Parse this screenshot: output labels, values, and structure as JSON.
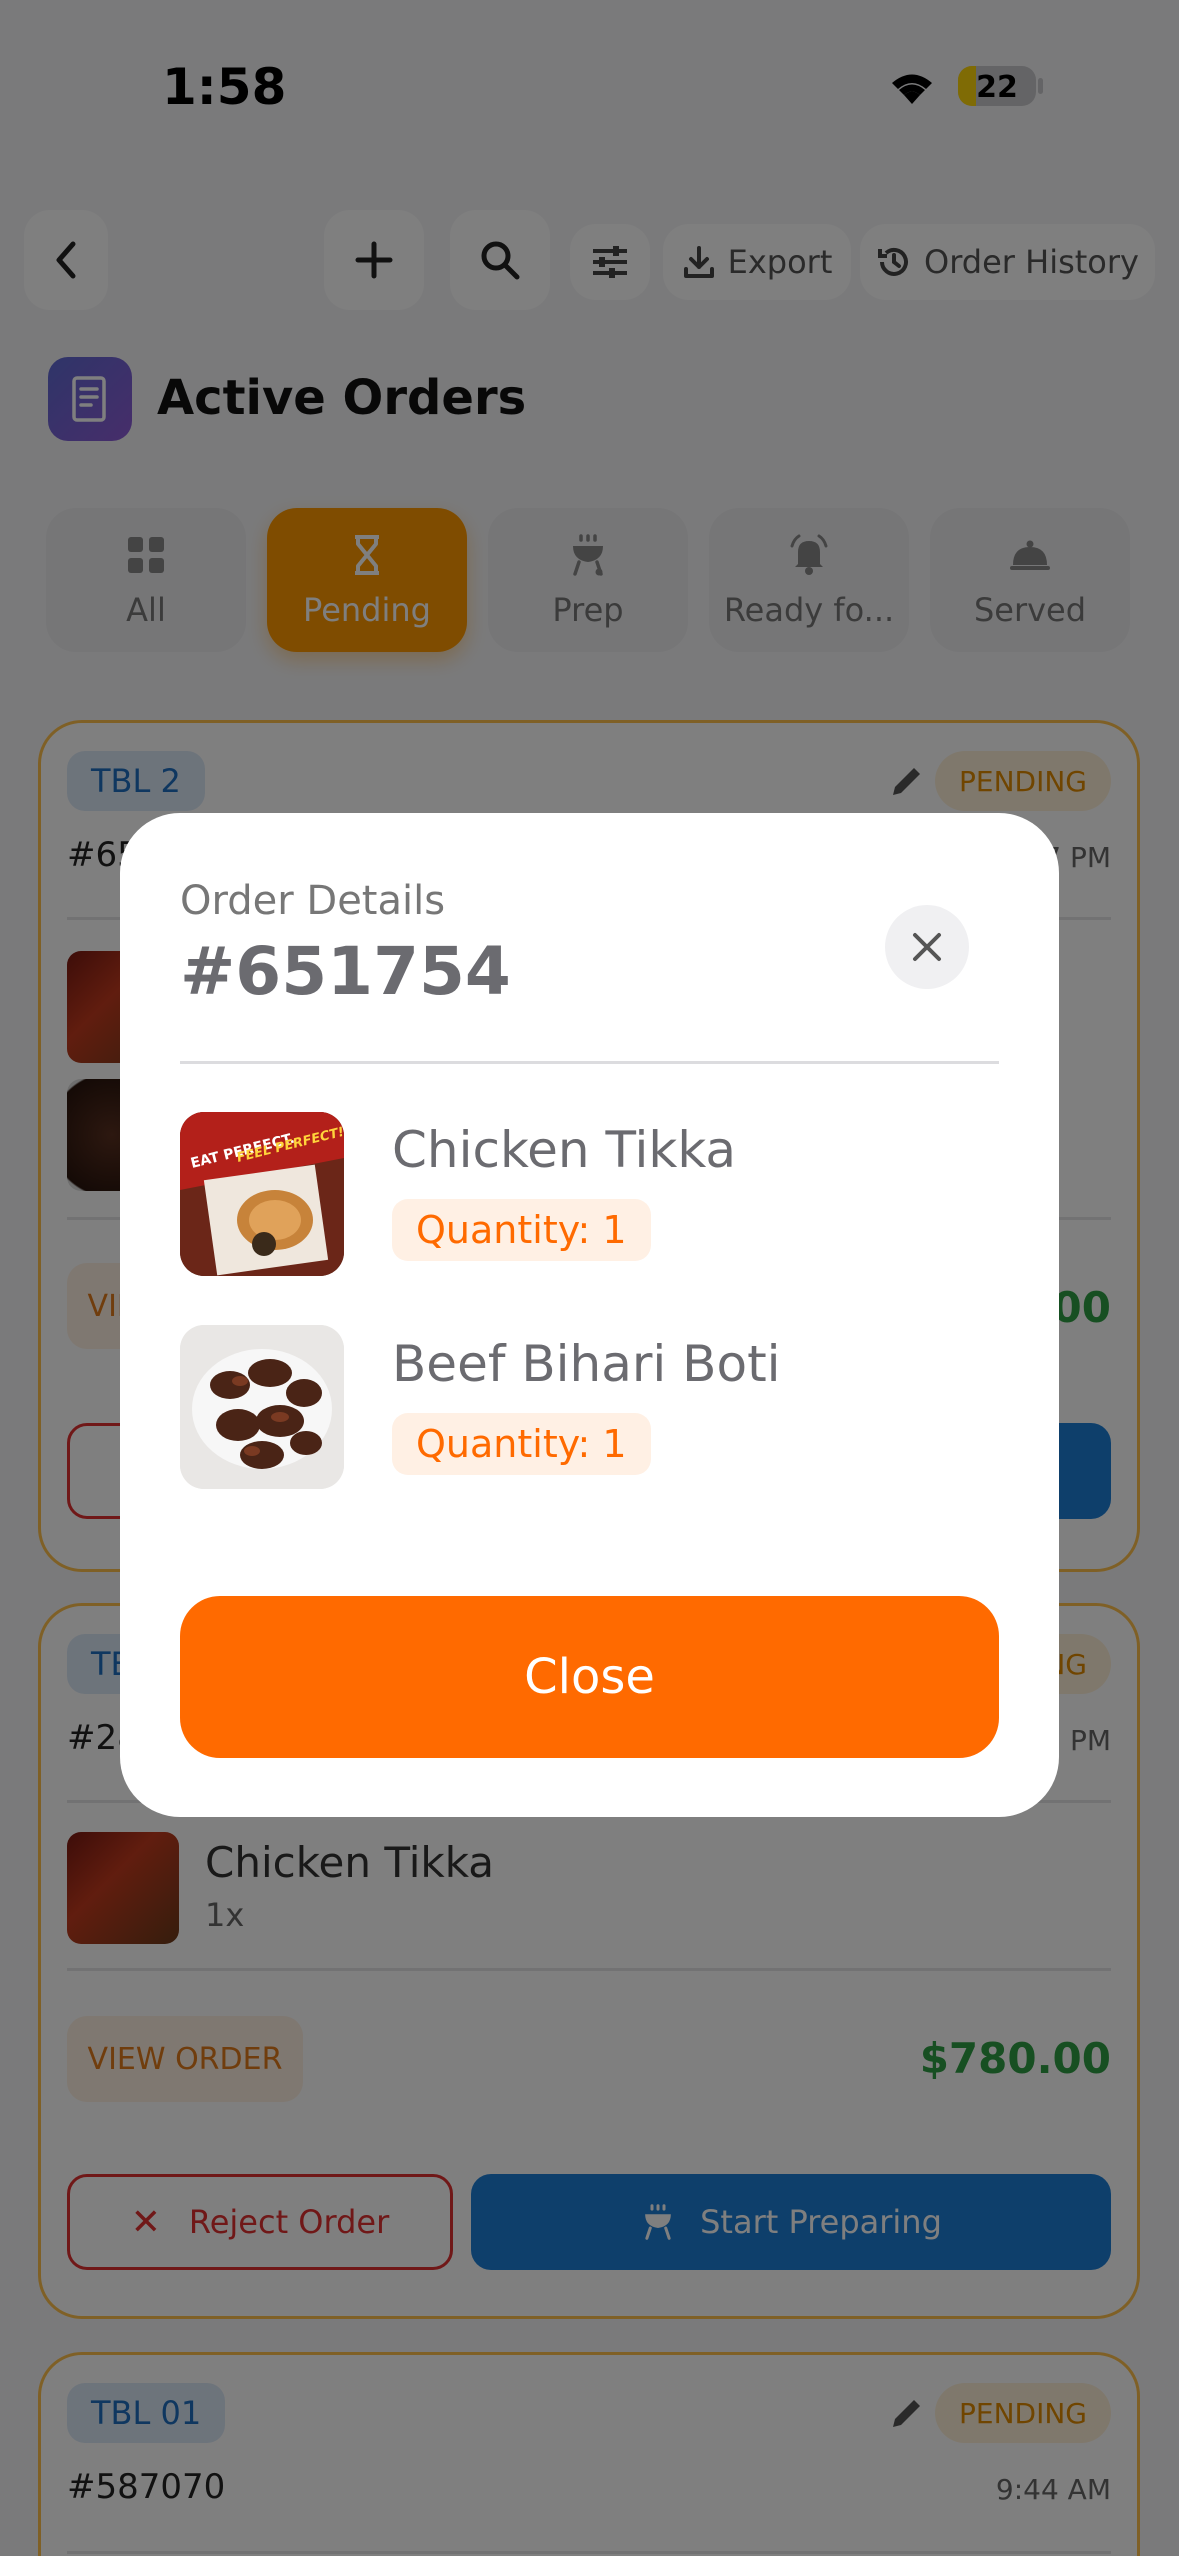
{
  "status_bar": {
    "time": "1:58",
    "battery": "22"
  },
  "toolbar": {
    "export_label": "Export",
    "history_label": "Order History"
  },
  "header": {
    "title": "Active Orders"
  },
  "tabs": [
    {
      "label": "All",
      "icon": "grid-icon"
    },
    {
      "label": "Pending",
      "icon": "hourglass-icon",
      "active": true
    },
    {
      "label": "Prep",
      "icon": "grill-icon"
    },
    {
      "label": "Ready fo...",
      "icon": "bell-icon"
    },
    {
      "label": "Served",
      "icon": "cloche-icon"
    }
  ],
  "orders": [
    {
      "table": "TBL 2",
      "status": "PENDING",
      "number": "#651754",
      "time": "7 PM",
      "total": "$.00",
      "view_label": "VIEW ORDER"
    },
    {
      "table": "TBL",
      "status": "PENDING",
      "number": "#28",
      "time": "5 PM",
      "items": [
        {
          "name": "Chicken Tikka",
          "qty": "1x"
        }
      ],
      "view_label": "VIEW ORDER",
      "total": "$780.00",
      "reject_label": "Reject Order",
      "start_label": "Start Preparing"
    },
    {
      "table": "TBL 01",
      "status": "PENDING",
      "number": "#587070",
      "time": "9:44 AM"
    }
  ],
  "modal": {
    "subtitle": "Order Details",
    "order_number": "#651754",
    "items": [
      {
        "name": "Chicken Tikka",
        "quantity": "Quantity: 1",
        "thumb_text": "EAT PERFECT. FEEL PERFECT!"
      },
      {
        "name": "Beef Bihari Boti",
        "quantity": "Quantity: 1"
      }
    ],
    "close_label": "Close"
  },
  "colors": {
    "accent": "#ff6a00",
    "pending_tab": "#ff9900",
    "primary_blue": "#1c7ed6",
    "price_green": "#2f9e44",
    "reject_red": "#e03131"
  }
}
